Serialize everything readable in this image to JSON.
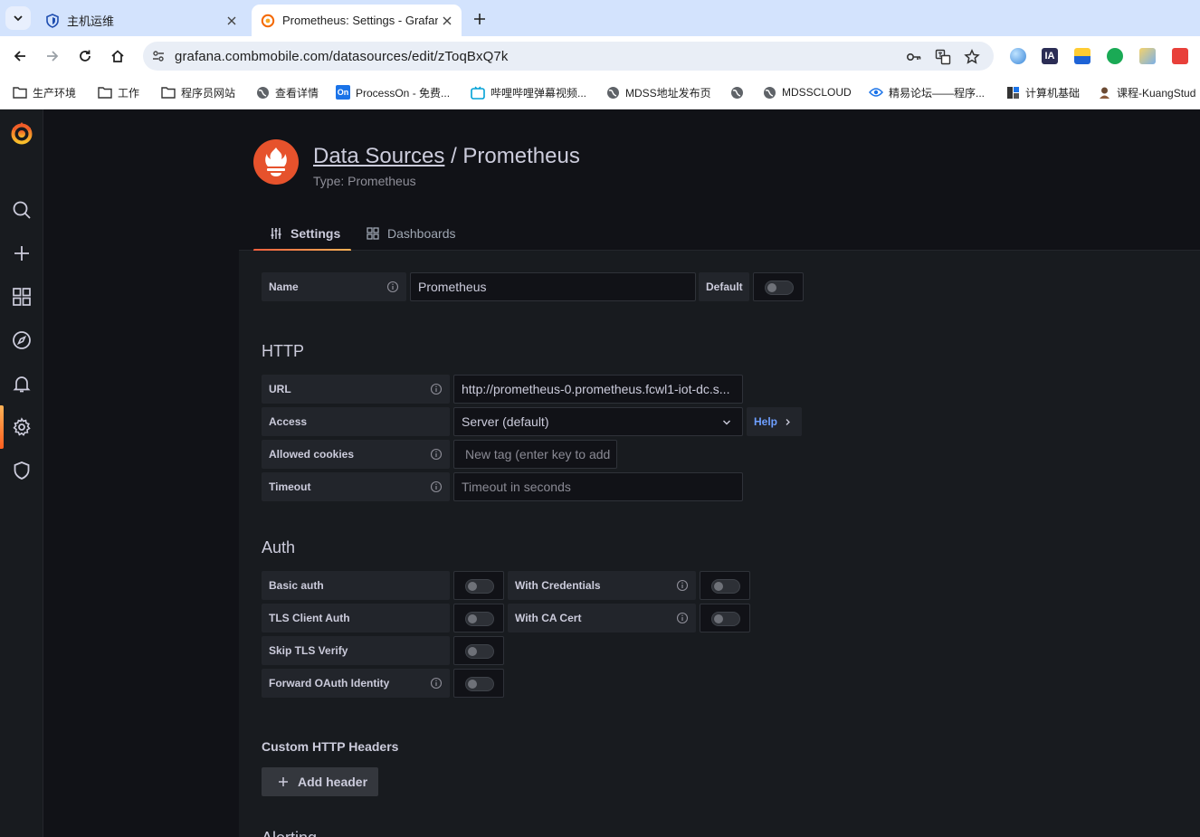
{
  "browser": {
    "tabs": [
      {
        "title": "主机运维",
        "active": false
      },
      {
        "title": "Prometheus: Settings - Grafana",
        "active": true
      }
    ],
    "url": "grafana.combmobile.com/datasources/edit/zToqBxQ7k",
    "bookmarks": [
      {
        "label": "生产环境",
        "icon": "folder-icon"
      },
      {
        "label": "工作",
        "icon": "folder-icon"
      },
      {
        "label": "程序员网站",
        "icon": "folder-icon"
      },
      {
        "label": "查看详情",
        "icon": "globe-icon"
      },
      {
        "label": "ProcessOn - 免费...",
        "icon": "processon-icon"
      },
      {
        "label": "哔哩哔哩弹幕视频...",
        "icon": "bilibili-icon"
      },
      {
        "label": "MDSS地址发布页",
        "icon": "globe-icon"
      },
      {
        "label": "",
        "icon": "globe-icon"
      },
      {
        "label": "MDSSCLOUD",
        "icon": "globe-icon"
      },
      {
        "label": "精易论坛——程序...",
        "icon": "eye-icon"
      },
      {
        "label": "计算机基础",
        "icon": "blocks-icon"
      },
      {
        "label": "课程-KuangStud",
        "icon": "avatar-icon"
      }
    ]
  },
  "page": {
    "breadcrumb_link": "Data Sources",
    "separator": " / ",
    "datasource_name": "Prometheus",
    "type_line": "Type: Prometheus",
    "tabs": [
      "Settings",
      "Dashboards"
    ]
  },
  "form": {
    "name_label": "Name",
    "name_value": "Prometheus",
    "default_label": "Default",
    "http_heading": "HTTP",
    "url_label": "URL",
    "url_value": "http://prometheus-0.prometheus.fcwl1-iot-dc.s...",
    "access_label": "Access",
    "access_value": "Server (default)",
    "help_label": "Help",
    "cookies_label": "Allowed cookies",
    "cookies_placeholder": "New tag (enter key to add",
    "timeout_label": "Timeout",
    "timeout_placeholder": "Timeout in seconds",
    "auth_heading": "Auth",
    "basic_auth": "Basic auth",
    "with_credentials": "With Credentials",
    "tls_client_auth": "TLS Client Auth",
    "with_ca_cert": "With CA Cert",
    "skip_tls": "Skip TLS Verify",
    "forward_oauth": "Forward OAuth Identity",
    "custom_headers_heading": "Custom HTTP Headers",
    "add_header": "Add header",
    "next_heading_partial": "Alerting"
  },
  "colors": {
    "accent": "#f55f3e",
    "link": "#6e9fff",
    "prometheus": "#e6522c"
  }
}
